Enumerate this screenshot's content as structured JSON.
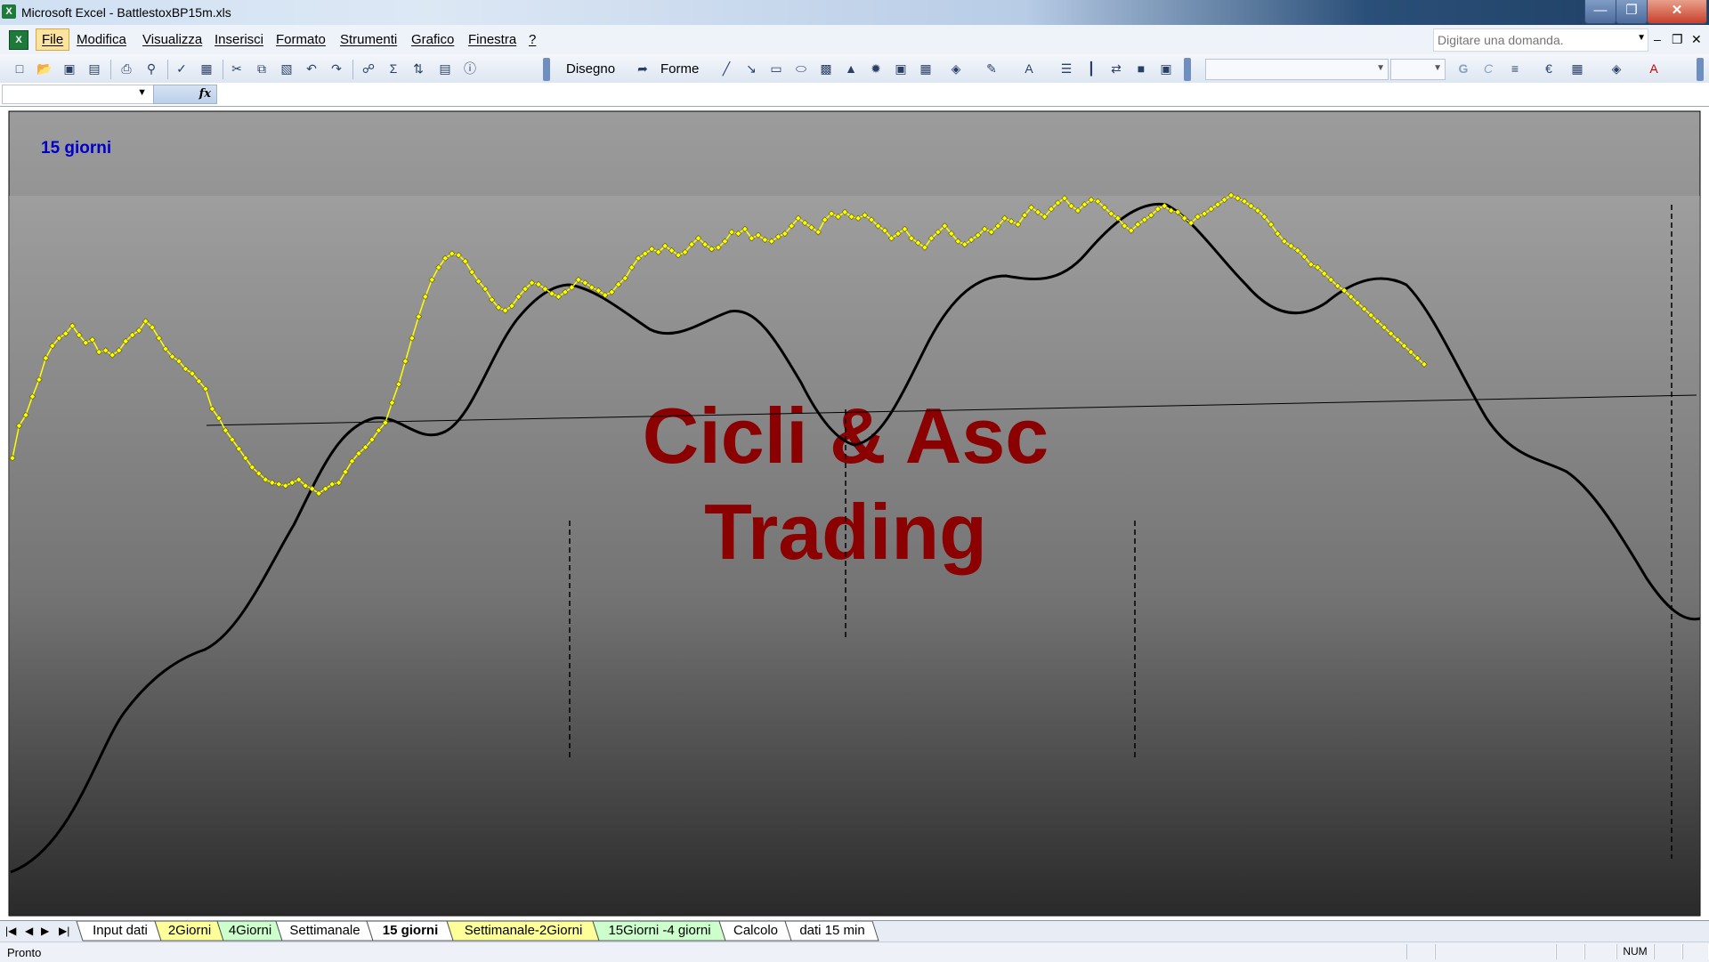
{
  "window": {
    "title": "Microsoft Excel - BattlestoxBP15m.xls",
    "app_icon": "excel-icon"
  },
  "menu": {
    "items": [
      "File",
      "Modifica",
      "Visualizza",
      "Inserisci",
      "Formato",
      "Strumenti",
      "Grafico",
      "Finestra",
      "?"
    ],
    "help_placeholder": "Digitare una domanda."
  },
  "toolbar": {
    "disegno_label": "Disegno",
    "forme_label": "Forme"
  },
  "formula_bar": {
    "name_box": "",
    "fx_symbol": "fx"
  },
  "chart": {
    "label": "15 giorni",
    "watermark_line1": "Cicli & Asc",
    "watermark_line2": "Trading",
    "colors": {
      "price": "#ffff00",
      "price_marker_stroke": "#555500",
      "cycle": "#000000",
      "label": "#0000cc",
      "watermark": "#8b0000",
      "bg_top": "#9c9c9c",
      "bg_bottom": "#262626"
    }
  },
  "chart_data": {
    "type": "line",
    "title": "15 giorni",
    "series": [
      {
        "y": [
          512,
          533,
          540,
          552,
          563,
          577,
          585,
          590,
          593,
          598,
          592,
          587,
          589,
          581,
          582,
          579,
          582,
          588,
          592,
          595,
          601,
          597,
          590,
          583,
          578,
          575,
          570,
          567,
          562,
          557,
          544,
          538,
          530,
          524,
          518,
          512,
          506,
          502,
          498,
          496,
          495,
          494,
          496,
          498,
          494,
          492,
          489,
          492,
          495,
          496,
          503,
          510,
          515,
          519,
          524,
          530,
          535,
          548,
          560,
          575,
          590,
          604,
          617,
          628,
          636,
          642,
          645,
          644,
          640,
          633,
          627,
          622,
          615,
          610,
          608,
          611,
          617,
          622,
          626,
          625,
          622,
          619,
          617,
          620,
          623,
          628,
          626,
          623,
          621,
          618,
          620,
          625,
          629,
          636,
          642,
          645,
          648,
          646,
          650,
          647,
          644,
          646,
          651,
          655,
          651,
          648,
          649,
          653,
          659,
          658,
          661,
          655,
          657,
          654,
          653,
          656,
          658,
          663,
          668,
          665,
          662,
          659,
          667,
          671,
          669,
          672,
          669,
          668,
          670,
          667,
          663,
          660,
          655,
          658,
          661,
          655,
          652,
          649,
          655,
          659,
          663,
          658,
          653,
          651,
          654,
          657,
          661,
          659,
          663,
          668,
          666,
          664,
          670,
          675,
          672,
          669,
          674,
          678,
          681,
          676,
          673,
          677,
          680,
          679,
          675,
          671,
          668,
          663,
          660,
          664,
          667,
          670,
          674,
          676,
          673,
          672,
          668,
          665,
          669,
          671,
          674,
          677,
          680,
          683,
          681,
          679,
          676,
          673,
          669,
          664,
          658,
          653,
          650,
          647,
          643,
          638,
          636,
          632,
          628,
          624,
          621,
          617,
          613,
          609,
          605,
          601,
          597,
          593,
          589,
          585,
          581,
          577,
          573
        ],
        "marker": "diamond"
      },
      {
        "name": "",
        "smooth": true,
        "marker": "none"
      }
    ],
    "y_axis": {
      "visible": false
    },
    "x_axis": {
      "visible": false
    },
    "grid": false,
    "legend": "none"
  },
  "sheet_tabs": {
    "items": [
      {
        "label": "Input dati",
        "color": "#ffffff",
        "active": false
      },
      {
        "label": "2Giorni",
        "color": "#ffff99",
        "active": false
      },
      {
        "label": "4Giorni",
        "color": "#ccffcc",
        "active": false
      },
      {
        "label": "Settimanale",
        "color": "#ffffff",
        "active": false
      },
      {
        "label": "15 giorni",
        "color": "#ffffff",
        "active": true
      },
      {
        "label": "Settimanale-2Giorni",
        "color": "#ffff99",
        "active": false
      },
      {
        "label": "15Giorni -4 giorni",
        "color": "#ccffcc",
        "active": false
      },
      {
        "label": "Calcolo",
        "color": "#ffffff",
        "active": false
      },
      {
        "label": "dati 15 min",
        "color": "#ffffff",
        "active": false
      }
    ]
  },
  "status": {
    "text": "Pronto",
    "num": "NUM"
  }
}
